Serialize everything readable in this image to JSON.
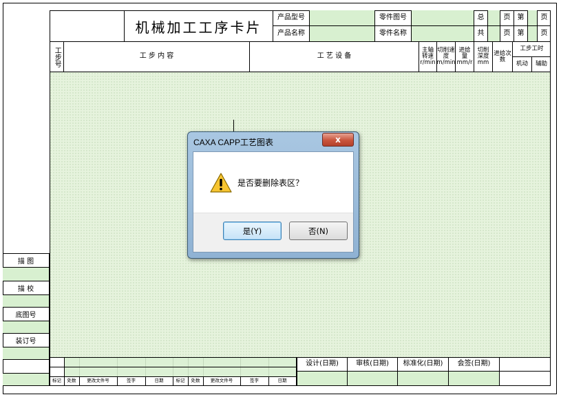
{
  "card": {
    "title": "机械加工工序卡片",
    "product_model_label": "产品型号",
    "product_name_label": "产品名称",
    "part_drawing_label": "零件图号",
    "part_name_label": "零件名称",
    "total_label": "总",
    "page_unit": "页",
    "page_no_label": "第",
    "count_label": "共",
    "page_unit2": "页",
    "page_no_label2": "第",
    "page_unit3": "页",
    "page_unit4": "页"
  },
  "columns": {
    "step_no": "工步号",
    "step_content": "工 步 内 容",
    "equipment": "工 艺 设 备",
    "spindle_speed": "主轴转速 r/min",
    "cut_speed": "切削速度 m/min",
    "feed": "进给量 mm/r",
    "cut_depth": "切削深度 mm",
    "feed_times": "进给次数",
    "step_hours": "工步工时",
    "machine_time": "机动",
    "aux_time": "辅助"
  },
  "left_labels": {
    "trace": "描 图",
    "check": "描 校",
    "base_no": "底图号",
    "binding_no": "装订号"
  },
  "footer": {
    "design": "设计(日期)",
    "review": "审核(日期)",
    "standard": "标准化(日期)",
    "sign": "会签(日期)",
    "marks": [
      "标记",
      "处数",
      "更改文件号",
      "签字",
      "日期",
      "标记",
      "处数",
      "更改文件号",
      "签字",
      "日期"
    ]
  },
  "dialog": {
    "title": "CAXA CAPP工艺图表",
    "close_glyph": "x",
    "message": "是否要删除表区？",
    "yes_label": "是(Y)",
    "no_label": "否(N)"
  },
  "colors": {
    "cell_green": "#d8f0d0",
    "dialog_frame": "#a9c7e2",
    "close_red": "#c9543c"
  }
}
